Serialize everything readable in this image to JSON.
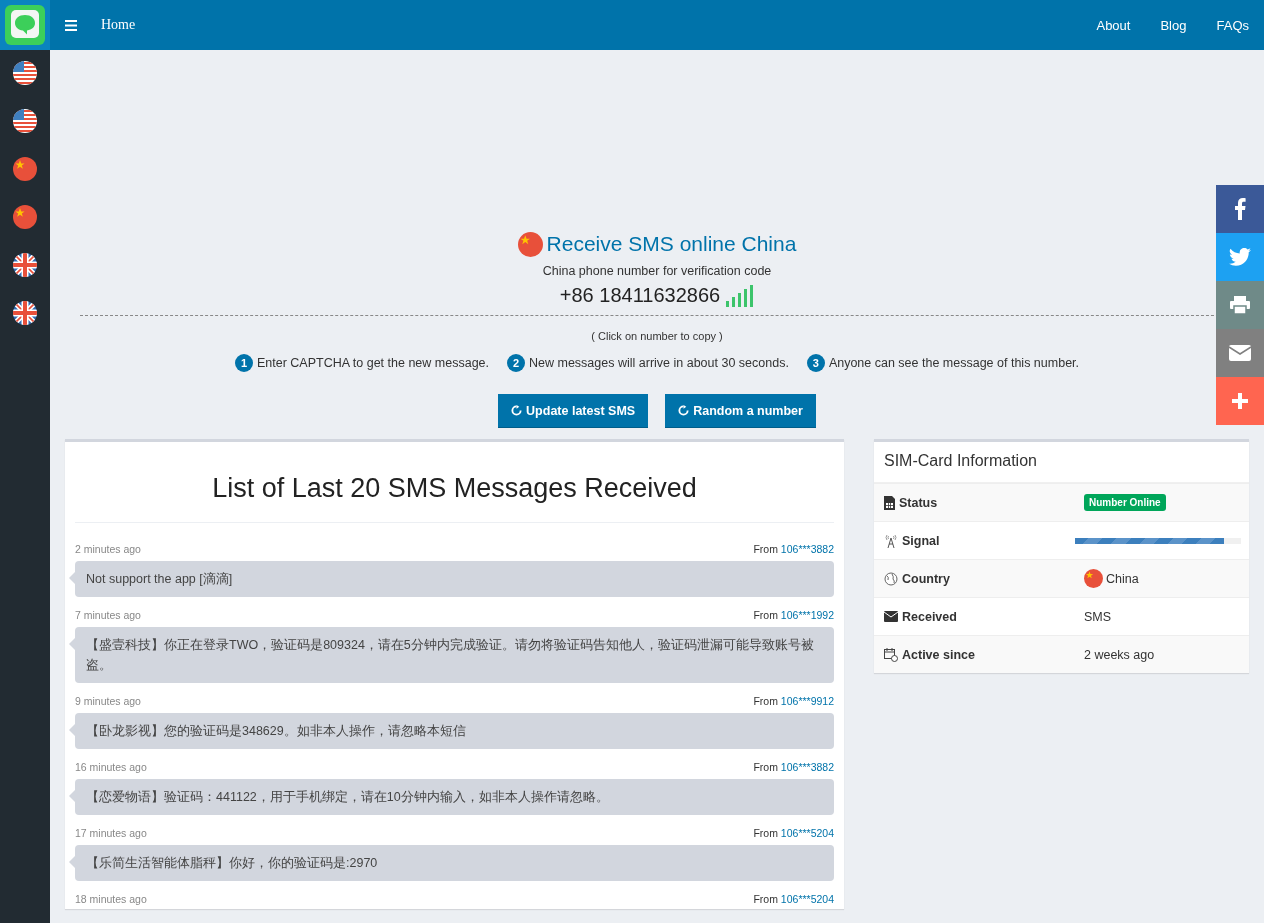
{
  "header": {
    "home": "Home",
    "nav": [
      "About",
      "Blog",
      "FAQs"
    ]
  },
  "sidebar": {
    "flags": [
      {
        "kind": "us"
      },
      {
        "kind": "us"
      },
      {
        "kind": "cn"
      },
      {
        "kind": "cn"
      },
      {
        "kind": "uk"
      },
      {
        "kind": "uk"
      }
    ]
  },
  "hero": {
    "title": "Receive SMS online China",
    "subtitle": "China phone number for verification code",
    "phone": "+86 18411632866",
    "hint": "( Click on number to copy )",
    "steps": [
      {
        "number": "1",
        "text": "Enter CAPTCHA to get the new message."
      },
      {
        "number": "2",
        "text": "New messages will arrive in about 30 seconds."
      },
      {
        "number": "3",
        "text": "Anyone can see the message of this number."
      }
    ],
    "buttons": [
      "Update latest SMS",
      "Random a number"
    ]
  },
  "messages": {
    "title": "List of Last 20 SMS Messages Received",
    "items": [
      {
        "time": "2 minutes ago",
        "from_label": "From",
        "sender": "106***3882",
        "text": "Not support the app [滴滴]"
      },
      {
        "time": "7 minutes ago",
        "from_label": "From",
        "sender": "106***1992",
        "text": "【盛壹科技】你正在登录TWO，验证码是809324，请在5分钟内完成验证。请勿将验证码告知他人，验证码泄漏可能导致账号被盗。"
      },
      {
        "time": "9 minutes ago",
        "from_label": "From",
        "sender": "106***9912",
        "text": "【卧龙影视】您的验证码是348629。如非本人操作，请忽略本短信"
      },
      {
        "time": "16 minutes ago",
        "from_label": "From",
        "sender": "106***3882",
        "text": "【恋爱物语】验证码：441122，用于手机绑定，请在10分钟内输入，如非本人操作请忽略。"
      },
      {
        "time": "17 minutes ago",
        "from_label": "From",
        "sender": "106***5204",
        "text": "【乐简生活智能体脂秤】你好，你的验证码是:2970"
      },
      {
        "time": "18 minutes ago",
        "from_label": "From",
        "sender": "106***5204"
      }
    ]
  },
  "sim_card": {
    "title": "SIM-Card Information",
    "rows": [
      {
        "kind": "status",
        "label": "Status",
        "value": "Number Online"
      },
      {
        "kind": "signal",
        "label": "Signal",
        "level": 0.9
      },
      {
        "kind": "country",
        "label": "Country",
        "value": "China"
      },
      {
        "kind": "received",
        "label": "Received",
        "value": "SMS"
      },
      {
        "kind": "active",
        "label": "Active since",
        "value": "2 weeks ago"
      }
    ]
  },
  "share": [
    {
      "kind": "facebook"
    },
    {
      "kind": "twitter"
    },
    {
      "kind": "print"
    },
    {
      "kind": "email"
    },
    {
      "kind": "more"
    }
  ]
}
